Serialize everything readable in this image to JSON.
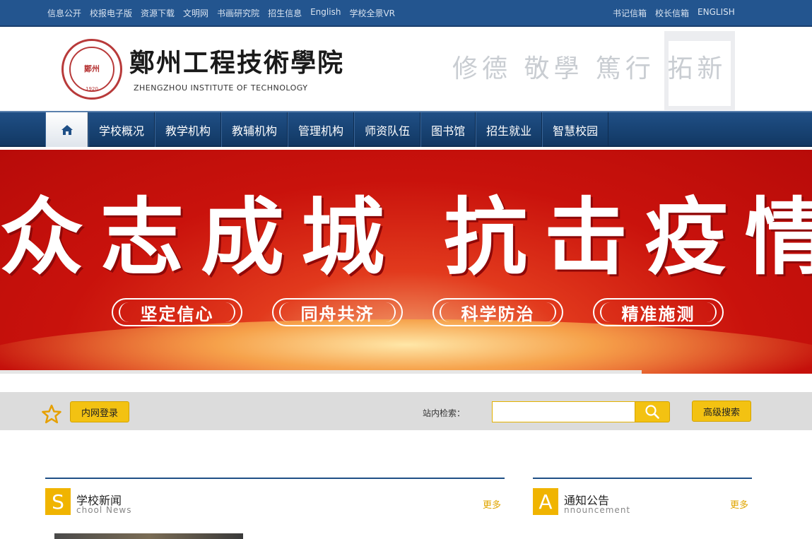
{
  "topbar": {
    "left_links": [
      "信息公开",
      "校报电子版",
      "资源下载",
      "文明网",
      "书画研究院",
      "招生信息",
      "English",
      "学校全景VR"
    ],
    "right_links": [
      "书记信箱",
      "校长信箱",
      "ENGLISH"
    ]
  },
  "header": {
    "seal_text": "鄭州",
    "seal_year": "1920",
    "school_name_cn": "鄭州工程技術學院",
    "school_name_en": "ZHENGZHOU INSTITUTE OF  TECHNOLOGY",
    "motto": "修德 敬學 篤行 拓新"
  },
  "nav": {
    "home_icon": "home-icon",
    "items": [
      "学校概况",
      "教学机构",
      "教辅机构",
      "管理机构",
      "师资队伍",
      "图书馆",
      "招生就业",
      "智慧校园"
    ]
  },
  "banner": {
    "slogan_part1": "众志成城",
    "slogan_part2": "抗击疫情",
    "pills": [
      "坚定信心",
      "同舟共济",
      "科学防治",
      "精准施测"
    ],
    "slide_progress": 0.79
  },
  "search": {
    "login_label": "内网登录",
    "label": "站内检索：",
    "placeholder": "",
    "value": "",
    "search_icon": "search-icon",
    "advanced_label": "高级搜索"
  },
  "sections": {
    "news": {
      "letter": "S",
      "title": "学校新闻",
      "subtitle": "chool News",
      "more": "更多"
    },
    "notice": {
      "letter": "A",
      "title": "通知公告",
      "subtitle": "nnouncement",
      "more": "更多"
    }
  },
  "colors": {
    "topbar": "#23558f",
    "nav": "#1f4f86",
    "accent": "#f3c212",
    "banner_red": "#c9120c"
  }
}
